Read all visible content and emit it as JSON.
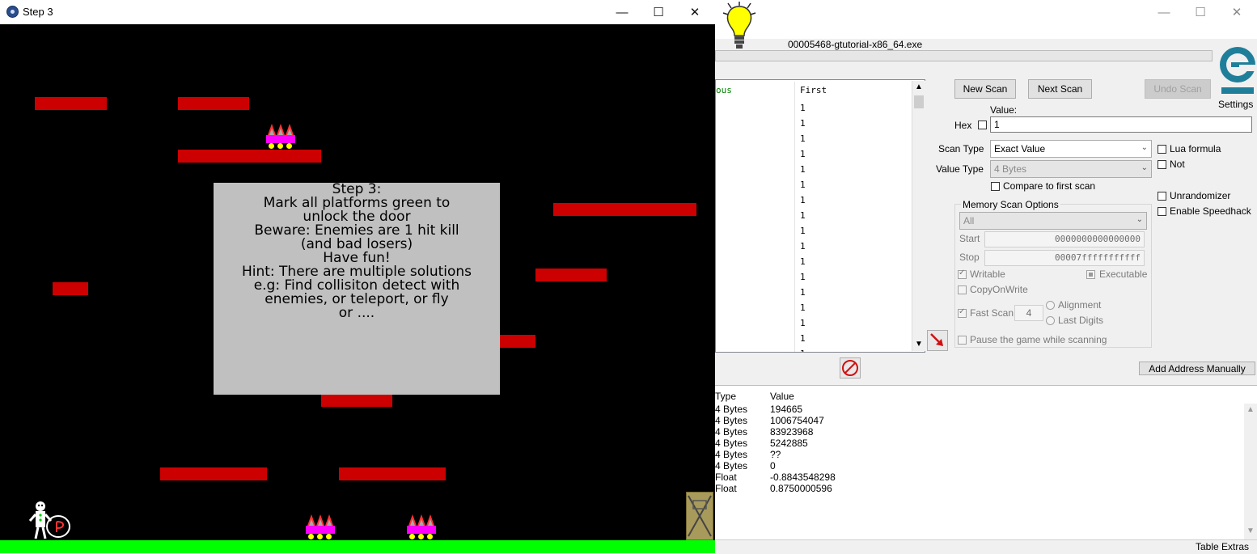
{
  "game": {
    "title": "Step 3",
    "window_controls": {
      "minimize": "—",
      "maximize": "☐",
      "close": "✕"
    },
    "info_lines": [
      "Step 3:",
      "Mark all platforms green to",
      "unlock the door",
      "",
      "Beware: Enemies are 1 hit kill",
      "(and bad losers)",
      "",
      "",
      "Have fun!",
      "",
      "Hint: There are multiple solutions",
      "e.g: Find collisiton detect with",
      "enemies, or teleport, or fly",
      "or ...."
    ],
    "colors": {
      "platform": "#cc0000",
      "ground": "#00ff00",
      "enemy": "#ff00ff",
      "background": "#000000"
    }
  },
  "ce": {
    "window_controls": {
      "minimize": "—",
      "maximize": "☐",
      "close": "✕"
    },
    "process_name": "00005468-gtutorial-x86_64.exe",
    "settings_label": "Settings",
    "scan_list": {
      "col_previous": "ous",
      "col_first": "First",
      "values": [
        "1",
        "1",
        "1",
        "1",
        "1",
        "1",
        "1",
        "1",
        "1",
        "1",
        "1",
        "1",
        "1",
        "1",
        "1",
        "1",
        "1"
      ]
    },
    "buttons": {
      "new_scan": "New Scan",
      "next_scan": "Next Scan",
      "undo_scan": "Undo Scan",
      "add_address": "Add Address Manually"
    },
    "value_label": "Value:",
    "hex_label": "Hex",
    "value_input": "1",
    "scan_type_label": "Scan Type",
    "scan_type_value": "Exact Value",
    "value_type_label": "Value Type",
    "value_type_value": "4 Bytes",
    "compare_first": "Compare to first scan",
    "lua_formula": "Lua formula",
    "not_label": "Not",
    "unrandomizer": "Unrandomizer",
    "enable_speedhack": "Enable Speedhack",
    "mem_options_label": "Memory Scan Options",
    "mem_region": "All",
    "start_label": "Start",
    "start_value": "0000000000000000",
    "stop_label": "Stop",
    "stop_value": "00007fffffffffff",
    "writable": "Writable",
    "executable": "Executable",
    "copy_on_write": "CopyOnWrite",
    "fast_scan": "Fast Scan",
    "fast_scan_value": "4",
    "alignment": "Alignment",
    "last_digits": "Last Digits",
    "pause_game": "Pause the game while scanning",
    "table_headers": {
      "type": "Type",
      "value": "Value"
    },
    "table_rows": [
      {
        "type": "4 Bytes",
        "value": "194665"
      },
      {
        "type": "4 Bytes",
        "value": "1006754047"
      },
      {
        "type": "4 Bytes",
        "value": "83923968"
      },
      {
        "type": "4 Bytes",
        "value": "5242885"
      },
      {
        "type": "4 Bytes",
        "value": "??"
      },
      {
        "type": "4 Bytes",
        "value": "0"
      },
      {
        "type": "Float",
        "value": "-0.8843548298"
      },
      {
        "type": "Float",
        "value": "0.8750000596"
      }
    ],
    "table_extras": "Table Extras",
    "colors": {
      "col_prev_text": "#008000"
    }
  }
}
